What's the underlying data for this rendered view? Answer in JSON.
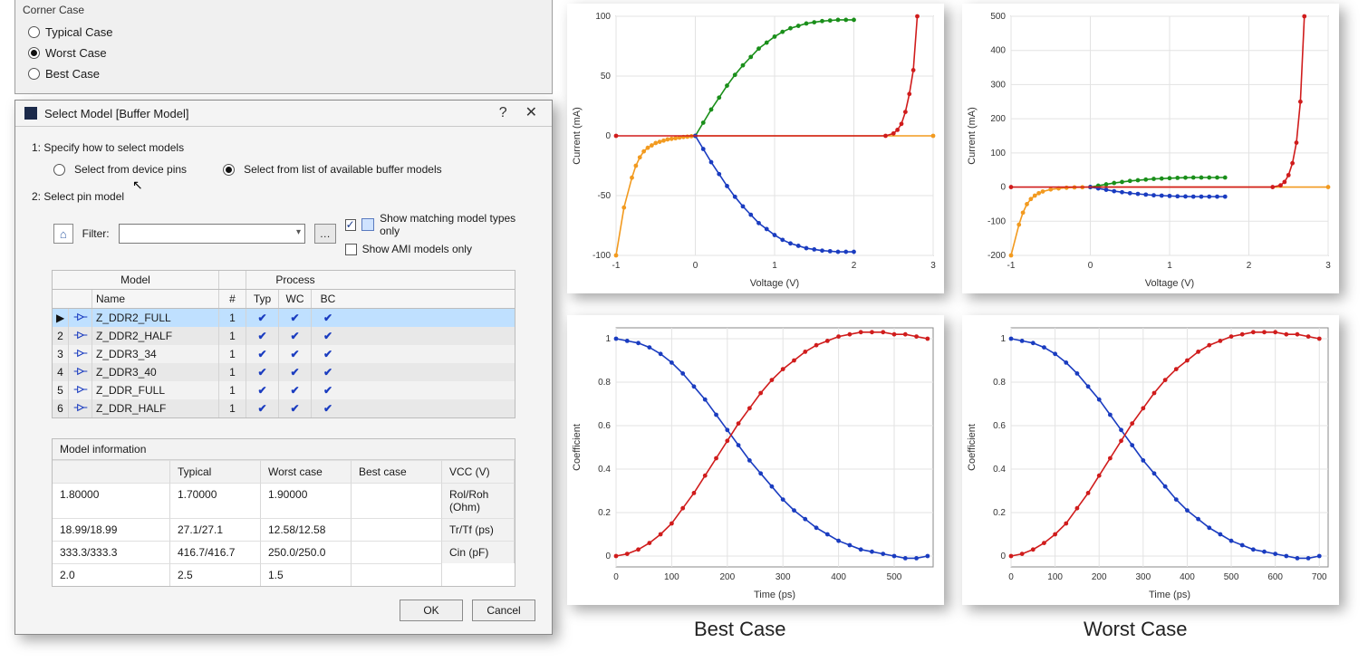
{
  "corner": {
    "legend": "Corner Case",
    "options": [
      "Typical Case",
      "Worst Case",
      "Best Case"
    ],
    "selected": "Worst Case"
  },
  "dialog": {
    "title": "Select Model [Buffer Model]",
    "step1_label": "1: Specify how to select models",
    "choice_pins": "Select from device pins",
    "choice_list": "Select from list of available buffer models",
    "choice_selected": "list",
    "step2_label": "2: Select pin model",
    "filter_label": "Filter:",
    "filter_value": "",
    "show_matching_label": "Show matching model types only",
    "show_matching": true,
    "show_ami_label": "Show AMI models only",
    "show_ami": false,
    "grid": {
      "group_model": "Model",
      "group_process": "Process",
      "col_name": "Name",
      "col_hash": "#",
      "col_typ": "Typ",
      "col_wc": "WC",
      "col_bc": "BC",
      "rows": [
        {
          "idx": "",
          "name": "Z_DDR2_FULL",
          "hash": "1",
          "typ": true,
          "wc": true,
          "bc": true,
          "selected": true,
          "marker": "▶"
        },
        {
          "idx": "2",
          "name": "Z_DDR2_HALF",
          "hash": "1",
          "typ": true,
          "wc": true,
          "bc": true
        },
        {
          "idx": "3",
          "name": "Z_DDR3_34",
          "hash": "1",
          "typ": true,
          "wc": true,
          "bc": true
        },
        {
          "idx": "4",
          "name": "Z_DDR3_40",
          "hash": "1",
          "typ": true,
          "wc": true,
          "bc": true
        },
        {
          "idx": "5",
          "name": "Z_DDR_FULL",
          "hash": "1",
          "typ": true,
          "wc": true,
          "bc": true
        },
        {
          "idx": "6",
          "name": "Z_DDR_HALF",
          "hash": "1",
          "typ": true,
          "wc": true,
          "bc": true
        }
      ]
    },
    "info": {
      "caption": "Model information",
      "cols": [
        "",
        "Typical",
        "Worst case",
        "Best case"
      ],
      "rows": [
        {
          "label": "VCC (V)",
          "typ": "1.80000",
          "wc": "1.70000",
          "bc": "1.90000"
        },
        {
          "label": "Rol/Roh (Ohm)",
          "typ": "18.99/18.99",
          "wc": "27.1/27.1",
          "bc": "12.58/12.58"
        },
        {
          "label": "Tr/Tf (ps)",
          "typ": "333.3/333.3",
          "wc": "416.7/416.7",
          "bc": "250.0/250.0"
        },
        {
          "label": "Cin (pF)",
          "typ": "2.0",
          "wc": "2.5",
          "bc": "1.5"
        }
      ]
    },
    "ok": "OK",
    "cancel": "Cancel"
  },
  "captions": {
    "best": "Best Case",
    "worst": "Worst Case"
  },
  "chart_data": [
    {
      "type": "line",
      "title": "",
      "xlabel": "Voltage (V)",
      "ylabel": "Current (mA)",
      "xlim": [
        -1,
        3
      ],
      "ylim": [
        -100,
        100
      ],
      "xticks": [
        -1,
        0,
        1,
        2,
        3
      ],
      "yticks": [
        -100,
        -50,
        0,
        50,
        100
      ],
      "series": [
        {
          "name": "orange",
          "color": "#f29a1f",
          "x": [
            -1,
            -0.9,
            -0.8,
            -0.75,
            -0.7,
            -0.65,
            -0.6,
            -0.55,
            -0.5,
            -0.45,
            -0.4,
            -0.35,
            -0.3,
            -0.25,
            -0.2,
            -0.15,
            -0.1,
            -0.05,
            0,
            3
          ],
          "y": [
            -100,
            -60,
            -35,
            -25,
            -18,
            -13,
            -10,
            -8,
            -6,
            -5,
            -4,
            -3,
            -2.5,
            -2,
            -1.5,
            -1,
            -0.7,
            -0.3,
            0,
            0
          ]
        },
        {
          "name": "green",
          "color": "#1a8f1a",
          "x": [
            0,
            0.1,
            0.2,
            0.3,
            0.4,
            0.5,
            0.6,
            0.7,
            0.8,
            0.9,
            1,
            1.1,
            1.2,
            1.3,
            1.4,
            1.5,
            1.6,
            1.7,
            1.8,
            1.9,
            2
          ],
          "y": [
            0,
            11,
            22,
            32,
            42,
            51,
            59,
            66,
            73,
            78,
            83,
            87,
            90,
            92,
            94,
            95,
            96,
            96.5,
            97,
            97,
            97
          ]
        },
        {
          "name": "blue",
          "color": "#1a3cc0",
          "x": [
            0,
            0.1,
            0.2,
            0.3,
            0.4,
            0.5,
            0.6,
            0.7,
            0.8,
            0.9,
            1,
            1.1,
            1.2,
            1.3,
            1.4,
            1.5,
            1.6,
            1.7,
            1.8,
            1.9,
            2
          ],
          "y": [
            0,
            -11,
            -22,
            -32,
            -42,
            -51,
            -59,
            -66,
            -73,
            -78,
            -83,
            -87,
            -90,
            -92,
            -94,
            -95,
            -96,
            -96.5,
            -97,
            -97,
            -97
          ]
        },
        {
          "name": "red",
          "color": "#d01c1c",
          "x": [
            -1,
            2.4,
            2.5,
            2.55,
            2.6,
            2.65,
            2.7,
            2.75,
            2.8
          ],
          "y": [
            0,
            0,
            2,
            5,
            10,
            20,
            35,
            55,
            100
          ]
        }
      ]
    },
    {
      "type": "line",
      "title": "",
      "xlabel": "Voltage (V)",
      "ylabel": "Current (mA)",
      "xlim": [
        -1,
        3
      ],
      "ylim": [
        -200,
        500
      ],
      "xticks": [
        -1,
        0,
        1,
        2,
        3
      ],
      "yticks": [
        -200,
        -100,
        0,
        100,
        200,
        300,
        400,
        500
      ],
      "series": [
        {
          "name": "orange",
          "color": "#f29a1f",
          "x": [
            -1,
            -0.9,
            -0.85,
            -0.8,
            -0.75,
            -0.7,
            -0.65,
            -0.6,
            -0.5,
            -0.4,
            -0.3,
            -0.2,
            -0.1,
            0,
            3
          ],
          "y": [
            -200,
            -110,
            -75,
            -50,
            -35,
            -25,
            -18,
            -13,
            -7,
            -4,
            -2,
            -1,
            -0.5,
            0,
            0
          ]
        },
        {
          "name": "green",
          "color": "#1a8f1a",
          "x": [
            0,
            0.1,
            0.2,
            0.3,
            0.4,
            0.5,
            0.6,
            0.7,
            0.8,
            0.9,
            1,
            1.1,
            1.2,
            1.3,
            1.4,
            1.5,
            1.6,
            1.7
          ],
          "y": [
            0,
            4,
            8,
            12,
            15,
            18,
            20,
            22,
            24,
            25,
            26,
            27,
            27.5,
            28,
            28,
            28,
            28,
            28
          ]
        },
        {
          "name": "blue",
          "color": "#1a3cc0",
          "x": [
            0,
            0.1,
            0.2,
            0.3,
            0.4,
            0.5,
            0.6,
            0.7,
            0.8,
            0.9,
            1,
            1.1,
            1.2,
            1.3,
            1.4,
            1.5,
            1.6,
            1.7
          ],
          "y": [
            0,
            -4,
            -8,
            -12,
            -15,
            -18,
            -20,
            -22,
            -24,
            -25,
            -26,
            -27,
            -27.5,
            -28,
            -28,
            -28,
            -28,
            -28
          ]
        },
        {
          "name": "red",
          "color": "#d01c1c",
          "x": [
            -1,
            2.3,
            2.4,
            2.45,
            2.5,
            2.55,
            2.6,
            2.65,
            2.7
          ],
          "y": [
            0,
            0,
            5,
            15,
            35,
            70,
            130,
            250,
            500
          ]
        }
      ]
    },
    {
      "type": "line",
      "title": "",
      "xlabel": "Time (ps)",
      "ylabel": "Coefficient",
      "xlim": [
        0,
        570
      ],
      "ylim": [
        -0.05,
        1.05
      ],
      "xticks": [
        0,
        100,
        200,
        300,
        400,
        500
      ],
      "yticks": [
        0,
        0.2,
        0.4,
        0.6,
        0.8,
        1
      ],
      "series": [
        {
          "name": "falling",
          "color": "#1a3cc0",
          "x": [
            0,
            20,
            40,
            60,
            80,
            100,
            120,
            140,
            160,
            180,
            200,
            220,
            240,
            260,
            280,
            300,
            320,
            340,
            360,
            380,
            400,
            420,
            440,
            460,
            480,
            500,
            520,
            540,
            560
          ],
          "y": [
            1.0,
            0.99,
            0.98,
            0.96,
            0.93,
            0.89,
            0.84,
            0.78,
            0.72,
            0.65,
            0.58,
            0.51,
            0.44,
            0.38,
            0.32,
            0.26,
            0.21,
            0.17,
            0.13,
            0.1,
            0.07,
            0.05,
            0.03,
            0.02,
            0.01,
            0.0,
            -0.01,
            -0.01,
            0.0
          ]
        },
        {
          "name": "rising",
          "color": "#d01c1c",
          "x": [
            0,
            20,
            40,
            60,
            80,
            100,
            120,
            140,
            160,
            180,
            200,
            220,
            240,
            260,
            280,
            300,
            320,
            340,
            360,
            380,
            400,
            420,
            440,
            460,
            480,
            500,
            520,
            540,
            560
          ],
          "y": [
            0.0,
            0.01,
            0.03,
            0.06,
            0.1,
            0.15,
            0.22,
            0.29,
            0.37,
            0.45,
            0.53,
            0.61,
            0.68,
            0.75,
            0.81,
            0.86,
            0.9,
            0.94,
            0.97,
            0.99,
            1.01,
            1.02,
            1.03,
            1.03,
            1.03,
            1.02,
            1.02,
            1.01,
            1.0
          ]
        }
      ]
    },
    {
      "type": "line",
      "title": "",
      "xlabel": "Time (ps)",
      "ylabel": "Coefficient",
      "xlim": [
        0,
        720
      ],
      "ylim": [
        -0.05,
        1.05
      ],
      "xticks": [
        0,
        100,
        200,
        300,
        400,
        500,
        600,
        700
      ],
      "yticks": [
        0,
        0.2,
        0.4,
        0.6,
        0.8,
        1
      ],
      "series": [
        {
          "name": "falling",
          "color": "#1a3cc0",
          "x": [
            0,
            25,
            50,
            75,
            100,
            125,
            150,
            175,
            200,
            225,
            250,
            275,
            300,
            325,
            350,
            375,
            400,
            425,
            450,
            475,
            500,
            525,
            550,
            575,
            600,
            625,
            650,
            675,
            700
          ],
          "y": [
            1.0,
            0.99,
            0.98,
            0.96,
            0.93,
            0.89,
            0.84,
            0.78,
            0.72,
            0.65,
            0.58,
            0.51,
            0.44,
            0.38,
            0.32,
            0.26,
            0.21,
            0.17,
            0.13,
            0.1,
            0.07,
            0.05,
            0.03,
            0.02,
            0.01,
            0.0,
            -0.01,
            -0.01,
            0.0
          ]
        },
        {
          "name": "rising",
          "color": "#d01c1c",
          "x": [
            0,
            25,
            50,
            75,
            100,
            125,
            150,
            175,
            200,
            225,
            250,
            275,
            300,
            325,
            350,
            375,
            400,
            425,
            450,
            475,
            500,
            525,
            550,
            575,
            600,
            625,
            650,
            675,
            700
          ],
          "y": [
            0.0,
            0.01,
            0.03,
            0.06,
            0.1,
            0.15,
            0.22,
            0.29,
            0.37,
            0.45,
            0.53,
            0.61,
            0.68,
            0.75,
            0.81,
            0.86,
            0.9,
            0.94,
            0.97,
            0.99,
            1.01,
            1.02,
            1.03,
            1.03,
            1.03,
            1.02,
            1.02,
            1.01,
            1.0
          ]
        }
      ]
    }
  ]
}
